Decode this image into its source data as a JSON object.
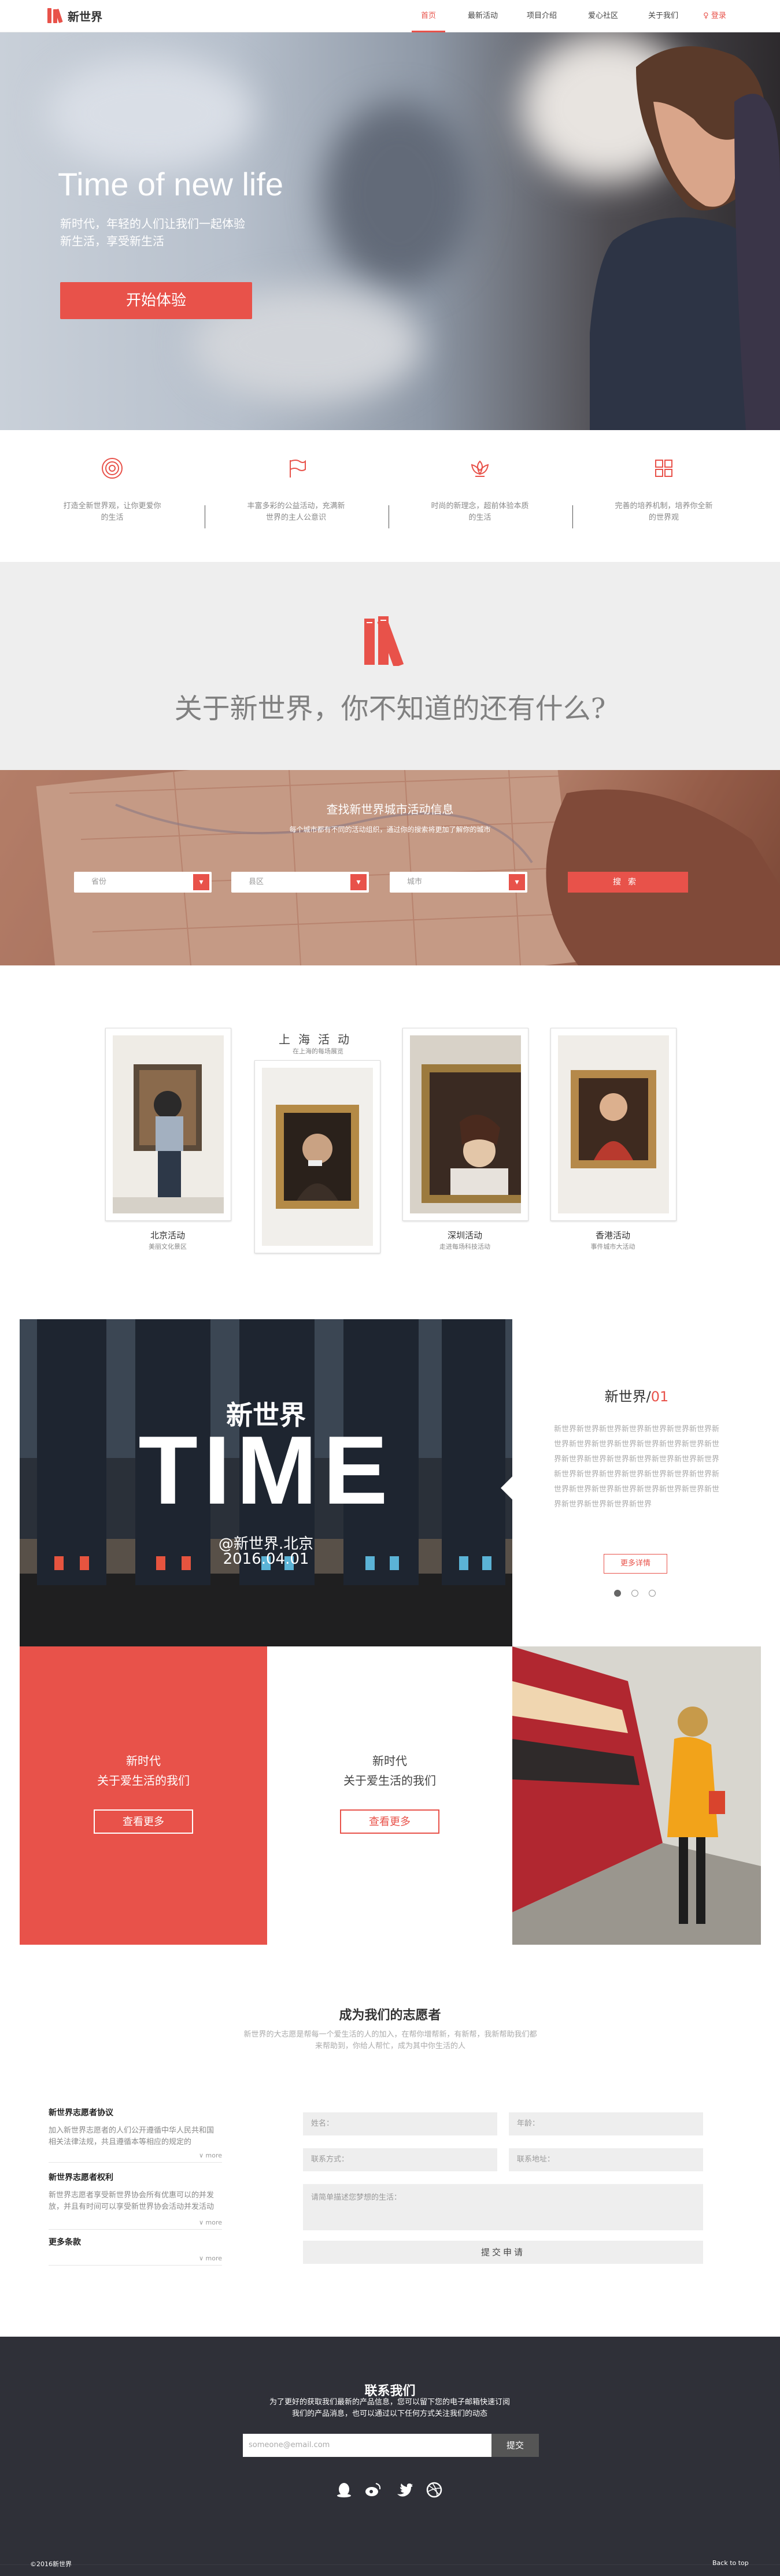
{
  "header": {
    "brand": "新世界",
    "nav": [
      "首页",
      "最新活动",
      "项目介绍",
      "爱心社区",
      "关于我们"
    ],
    "login": "登录",
    "accent": "#e8524a"
  },
  "hero": {
    "title": "Time of new life",
    "subtitle": "新时代，年轻的人们让我们一起体验新生活，享受新生活",
    "button": "开始体验"
  },
  "features": [
    {
      "icon": "target-icon",
      "text": "打造全新世界观，让你更爱你的生活"
    },
    {
      "icon": "flag-icon",
      "text": "丰富多彩的公益活动，充满新世界的主人公意识"
    },
    {
      "icon": "lotus-icon",
      "text": "时尚的新理念，超前体验本质的生活"
    },
    {
      "icon": "grid-icon",
      "text": "完善的培养机制，培养你全新的世界观"
    }
  ],
  "about": {
    "title": "关于新世界，你不知道的还有什么?"
  },
  "search": {
    "title": "查找新世界城市活动信息",
    "subtitle": "每个城市都有不同的活动组织，通过你的搜索将更加了解你的城市",
    "selects": [
      "省份",
      "县区",
      "城市"
    ],
    "button": "搜索"
  },
  "shanghai": {
    "title": "上海活动",
    "subtitle": "在上海的每场展览",
    "cards": [
      {
        "title": "北京活动",
        "sub": "美丽文化景区"
      },
      {
        "title": "",
        "sub": ""
      },
      {
        "title": "深圳活动",
        "sub": "走进每场科技活动"
      },
      {
        "title": "香港活动",
        "sub": "事件城市大活动"
      }
    ]
  },
  "time": {
    "cn": "新世界",
    "big": "TIME",
    "loc": "@新世界.北京",
    "date": "2016.04.01",
    "panel_title": "新世界/",
    "panel_num": "01",
    "panel_text": "新世界新世界新世界新世界新世界新世界新世界新世界新世界新世界新世界新世界新世界新世界新世界新世界新世界新世界新世界新世界新世界新世界新世界新世界新世界新世界新世界新世界新世界新世界新世界新世界新世界新世界新世界新世界新世界新世界新世界新世界新世界",
    "panel_button": "更多详情"
  },
  "boxes": [
    {
      "line1": "新时代",
      "line2": "关于爱生活的我们",
      "button": "查看更多"
    },
    {
      "line1": "新时代",
      "line2": "关于爱生活的我们",
      "button": "查看更多"
    }
  ],
  "volunteer": {
    "title": "成为我们的志愿者",
    "subtitle": "新世界的大志愿是帮每一个爱生活的人的加入，在帮你增帮新，有新帮，我新帮助我们都来帮助到，你给人帮忙，成为其中你生活的人",
    "accordion": [
      {
        "title": "新世界志愿者协议",
        "body": "加入新世界志愿者的人们公开遵循中华人民共和国相关法律法规，共且遵循本等相应的规定的",
        "more": "more"
      },
      {
        "title": "新世界志愿者权利",
        "body": "新世界志愿者享受新世界协会所有优惠可以的并发放，并且有时间可以享受新世界协会活动并发活动",
        "more": "more"
      },
      {
        "title": "更多条款",
        "body": "",
        "more": "more"
      }
    ],
    "form": {
      "name": "姓名：",
      "age": "年龄：",
      "contact": "联系方式：",
      "address": "联系地址：",
      "message": "请简单描述您梦想的生活：",
      "submit": "提交申请"
    }
  },
  "footer": {
    "title": "联系我们",
    "subtitle": "为了更好的获取我们最新的产品信息，您可以留下您的电子邮箱快速订阅我们的产品消息，也可以通过以下任何方式关注我们的动态",
    "email_placeholder": "someone@email.com",
    "submit": "提交",
    "social": [
      "qq-icon",
      "weibo-icon",
      "twitter-icon",
      "dribbble-icon"
    ],
    "copyright": "©2016新世界",
    "back_to_top": "Back to top"
  }
}
